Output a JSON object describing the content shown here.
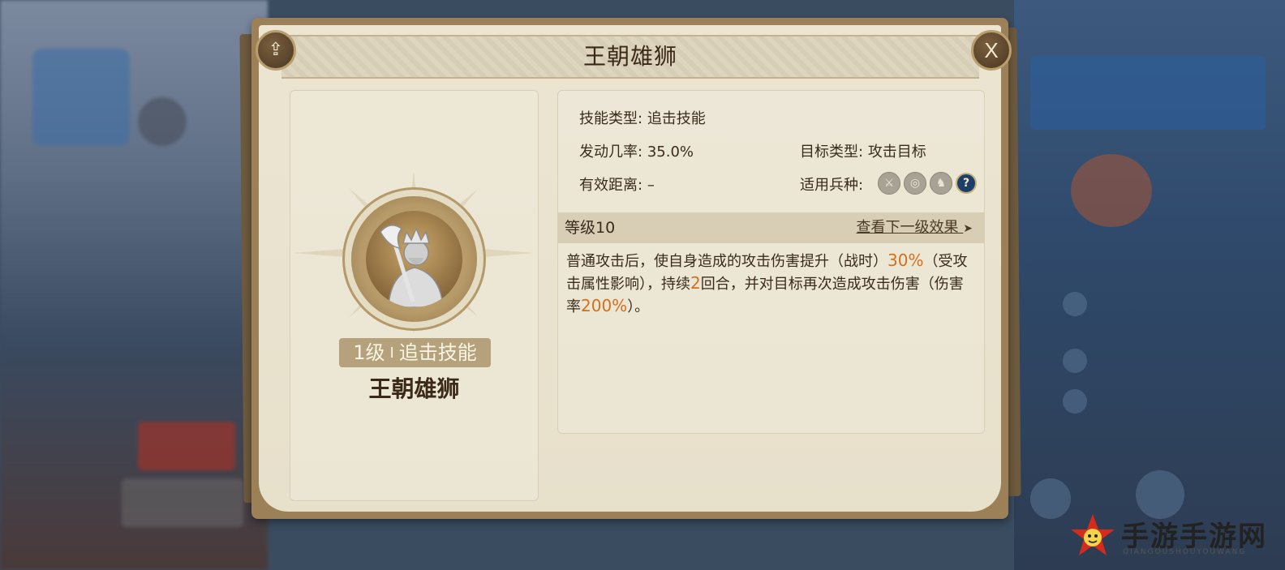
{
  "dialog": {
    "title": "王朝雄狮",
    "share_icon": "share-icon",
    "close_label": "X"
  },
  "skill": {
    "level_tag": "1级",
    "tag_separator": "I",
    "category_tag": "追击技能",
    "name": "王朝雄狮",
    "portrait_icon": "armored-axe-warrior-icon"
  },
  "details": {
    "skill_type_label": "技能类型:",
    "skill_type_value": "追击技能",
    "trigger_rate_label": "发动几率:",
    "trigger_rate_value": "35.0%",
    "target_type_label": "目标类型:",
    "target_type_value": "攻击目标",
    "range_label": "有效距离:",
    "range_value": "–",
    "unit_types_label": "适用兵种:",
    "unit_types": [
      {
        "icon": "infantry-sword-icon",
        "glyph": "⚔"
      },
      {
        "icon": "archer-target-icon",
        "glyph": "◎"
      },
      {
        "icon": "cavalry-horse-icon",
        "glyph": "♞"
      },
      {
        "icon": "help-icon",
        "glyph": "?"
      }
    ]
  },
  "level": {
    "label": "等级10",
    "next_link": "查看下一级效果",
    "next_arrow": "➤"
  },
  "description": {
    "part1": "普通攻击后，使自身造成的攻击伤害提升（战时）",
    "val1": "30%",
    "part2": "（受攻击属性影响），持续",
    "val2": "2",
    "part3": "回合，并对目标再次造成攻击伤害（伤害率",
    "val3": "200%",
    "part4": "）。"
  },
  "watermark": {
    "text": "手游手游网",
    "sub": "QIANGOUSHOUYOUWANG"
  },
  "colors": {
    "highlight": "#d3701c",
    "frame": "#9c8058",
    "paper": "#ebe5d2"
  }
}
